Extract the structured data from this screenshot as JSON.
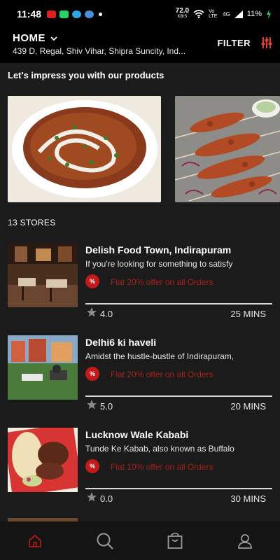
{
  "status_bar": {
    "time": "11:48",
    "speed_value": "72.0",
    "speed_unit": "KB/S",
    "network_1": "Vo LTE",
    "network_2": "4G",
    "battery": "11%"
  },
  "header": {
    "location_label": "HOME",
    "address": "439 D, Regal, Shiv Vihar, Shipra Suncity, Ind...",
    "filter_label": "FILTER"
  },
  "promo": {
    "title": "Let's impress you with our products",
    "items": [
      "dal-makhani-image",
      "kebab-skewers-image"
    ]
  },
  "stores": {
    "count_label": "13 STORES",
    "items": [
      {
        "name": "Delish Food Town, Indirapuram",
        "description": "If you're looking for something to satisfy",
        "offer_badge": "%",
        "offer": "Flat 20% offer on all Orders",
        "rating": "4.0",
        "eta": "25 MINS"
      },
      {
        "name": "Delhi6 ki haveli",
        "description": "Amidst the hustle-bustle of Indirapuram,",
        "offer_badge": "%",
        "offer": "Flat 20% offer on all Orders",
        "rating": "5.0",
        "eta": "20 MINS"
      },
      {
        "name": "Lucknow Wale Kababi",
        "description": "Tunde Ke Kabab, also known as Buffalo",
        "offer_badge": "%",
        "offer": "Flat 10% offer on all Orders",
        "rating": "0.0",
        "eta": "30 MINS"
      }
    ]
  },
  "bottom_nav": {
    "items": [
      "home-icon",
      "search-icon",
      "bag-icon",
      "profile-icon"
    ],
    "active_color": "#c21a1a",
    "inactive_color": "#9a9a9a"
  },
  "colors": {
    "background": "#1b1b1b",
    "header": "#000000",
    "accent": "#c21a1a",
    "offer_text": "#a8201a"
  }
}
